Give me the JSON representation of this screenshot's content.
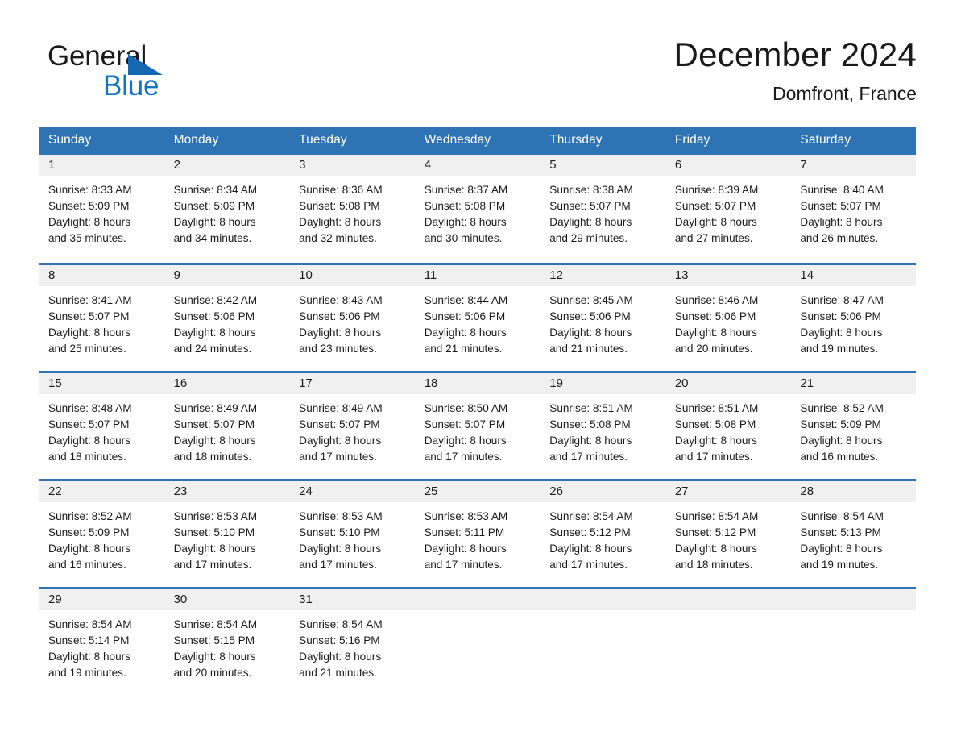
{
  "brand": {
    "name_top": "General",
    "name_bottom": "Blue",
    "accent_color": "#1174c4",
    "triangle_color": "#1667b2"
  },
  "header": {
    "title": "December 2024",
    "subtitle": "Domfront, France",
    "header_bg_color": "#2e74b5",
    "row_rule_color": "#2e74b5",
    "daynum_band_color": "#f0f0f0"
  },
  "weekday_headers": [
    "Sunday",
    "Monday",
    "Tuesday",
    "Wednesday",
    "Thursday",
    "Friday",
    "Saturday"
  ],
  "weeks": [
    [
      {
        "day": "1",
        "sunrise": "Sunrise: 8:33 AM",
        "sunset": "Sunset: 5:09 PM",
        "daylight_1": "Daylight: 8 hours",
        "daylight_2": "and 35 minutes."
      },
      {
        "day": "2",
        "sunrise": "Sunrise: 8:34 AM",
        "sunset": "Sunset: 5:09 PM",
        "daylight_1": "Daylight: 8 hours",
        "daylight_2": "and 34 minutes."
      },
      {
        "day": "3",
        "sunrise": "Sunrise: 8:36 AM",
        "sunset": "Sunset: 5:08 PM",
        "daylight_1": "Daylight: 8 hours",
        "daylight_2": "and 32 minutes."
      },
      {
        "day": "4",
        "sunrise": "Sunrise: 8:37 AM",
        "sunset": "Sunset: 5:08 PM",
        "daylight_1": "Daylight: 8 hours",
        "daylight_2": "and 30 minutes."
      },
      {
        "day": "5",
        "sunrise": "Sunrise: 8:38 AM",
        "sunset": "Sunset: 5:07 PM",
        "daylight_1": "Daylight: 8 hours",
        "daylight_2": "and 29 minutes."
      },
      {
        "day": "6",
        "sunrise": "Sunrise: 8:39 AM",
        "sunset": "Sunset: 5:07 PM",
        "daylight_1": "Daylight: 8 hours",
        "daylight_2": "and 27 minutes."
      },
      {
        "day": "7",
        "sunrise": "Sunrise: 8:40 AM",
        "sunset": "Sunset: 5:07 PM",
        "daylight_1": "Daylight: 8 hours",
        "daylight_2": "and 26 minutes."
      }
    ],
    [
      {
        "day": "8",
        "sunrise": "Sunrise: 8:41 AM",
        "sunset": "Sunset: 5:07 PM",
        "daylight_1": "Daylight: 8 hours",
        "daylight_2": "and 25 minutes."
      },
      {
        "day": "9",
        "sunrise": "Sunrise: 8:42 AM",
        "sunset": "Sunset: 5:06 PM",
        "daylight_1": "Daylight: 8 hours",
        "daylight_2": "and 24 minutes."
      },
      {
        "day": "10",
        "sunrise": "Sunrise: 8:43 AM",
        "sunset": "Sunset: 5:06 PM",
        "daylight_1": "Daylight: 8 hours",
        "daylight_2": "and 23 minutes."
      },
      {
        "day": "11",
        "sunrise": "Sunrise: 8:44 AM",
        "sunset": "Sunset: 5:06 PM",
        "daylight_1": "Daylight: 8 hours",
        "daylight_2": "and 21 minutes."
      },
      {
        "day": "12",
        "sunrise": "Sunrise: 8:45 AM",
        "sunset": "Sunset: 5:06 PM",
        "daylight_1": "Daylight: 8 hours",
        "daylight_2": "and 21 minutes."
      },
      {
        "day": "13",
        "sunrise": "Sunrise: 8:46 AM",
        "sunset": "Sunset: 5:06 PM",
        "daylight_1": "Daylight: 8 hours",
        "daylight_2": "and 20 minutes."
      },
      {
        "day": "14",
        "sunrise": "Sunrise: 8:47 AM",
        "sunset": "Sunset: 5:06 PM",
        "daylight_1": "Daylight: 8 hours",
        "daylight_2": "and 19 minutes."
      }
    ],
    [
      {
        "day": "15",
        "sunrise": "Sunrise: 8:48 AM",
        "sunset": "Sunset: 5:07 PM",
        "daylight_1": "Daylight: 8 hours",
        "daylight_2": "and 18 minutes."
      },
      {
        "day": "16",
        "sunrise": "Sunrise: 8:49 AM",
        "sunset": "Sunset: 5:07 PM",
        "daylight_1": "Daylight: 8 hours",
        "daylight_2": "and 18 minutes."
      },
      {
        "day": "17",
        "sunrise": "Sunrise: 8:49 AM",
        "sunset": "Sunset: 5:07 PM",
        "daylight_1": "Daylight: 8 hours",
        "daylight_2": "and 17 minutes."
      },
      {
        "day": "18",
        "sunrise": "Sunrise: 8:50 AM",
        "sunset": "Sunset: 5:07 PM",
        "daylight_1": "Daylight: 8 hours",
        "daylight_2": "and 17 minutes."
      },
      {
        "day": "19",
        "sunrise": "Sunrise: 8:51 AM",
        "sunset": "Sunset: 5:08 PM",
        "daylight_1": "Daylight: 8 hours",
        "daylight_2": "and 17 minutes."
      },
      {
        "day": "20",
        "sunrise": "Sunrise: 8:51 AM",
        "sunset": "Sunset: 5:08 PM",
        "daylight_1": "Daylight: 8 hours",
        "daylight_2": "and 17 minutes."
      },
      {
        "day": "21",
        "sunrise": "Sunrise: 8:52 AM",
        "sunset": "Sunset: 5:09 PM",
        "daylight_1": "Daylight: 8 hours",
        "daylight_2": "and 16 minutes."
      }
    ],
    [
      {
        "day": "22",
        "sunrise": "Sunrise: 8:52 AM",
        "sunset": "Sunset: 5:09 PM",
        "daylight_1": "Daylight: 8 hours",
        "daylight_2": "and 16 minutes."
      },
      {
        "day": "23",
        "sunrise": "Sunrise: 8:53 AM",
        "sunset": "Sunset: 5:10 PM",
        "daylight_1": "Daylight: 8 hours",
        "daylight_2": "and 17 minutes."
      },
      {
        "day": "24",
        "sunrise": "Sunrise: 8:53 AM",
        "sunset": "Sunset: 5:10 PM",
        "daylight_1": "Daylight: 8 hours",
        "daylight_2": "and 17 minutes."
      },
      {
        "day": "25",
        "sunrise": "Sunrise: 8:53 AM",
        "sunset": "Sunset: 5:11 PM",
        "daylight_1": "Daylight: 8 hours",
        "daylight_2": "and 17 minutes."
      },
      {
        "day": "26",
        "sunrise": "Sunrise: 8:54 AM",
        "sunset": "Sunset: 5:12 PM",
        "daylight_1": "Daylight: 8 hours",
        "daylight_2": "and 17 minutes."
      },
      {
        "day": "27",
        "sunrise": "Sunrise: 8:54 AM",
        "sunset": "Sunset: 5:12 PM",
        "daylight_1": "Daylight: 8 hours",
        "daylight_2": "and 18 minutes."
      },
      {
        "day": "28",
        "sunrise": "Sunrise: 8:54 AM",
        "sunset": "Sunset: 5:13 PM",
        "daylight_1": "Daylight: 8 hours",
        "daylight_2": "and 19 minutes."
      }
    ],
    [
      {
        "day": "29",
        "sunrise": "Sunrise: 8:54 AM",
        "sunset": "Sunset: 5:14 PM",
        "daylight_1": "Daylight: 8 hours",
        "daylight_2": "and 19 minutes."
      },
      {
        "day": "30",
        "sunrise": "Sunrise: 8:54 AM",
        "sunset": "Sunset: 5:15 PM",
        "daylight_1": "Daylight: 8 hours",
        "daylight_2": "and 20 minutes."
      },
      {
        "day": "31",
        "sunrise": "Sunrise: 8:54 AM",
        "sunset": "Sunset: 5:16 PM",
        "daylight_1": "Daylight: 8 hours",
        "daylight_2": "and 21 minutes."
      },
      {
        "day": "",
        "sunrise": "",
        "sunset": "",
        "daylight_1": "",
        "daylight_2": ""
      },
      {
        "day": "",
        "sunrise": "",
        "sunset": "",
        "daylight_1": "",
        "daylight_2": ""
      },
      {
        "day": "",
        "sunrise": "",
        "sunset": "",
        "daylight_1": "",
        "daylight_2": ""
      },
      {
        "day": "",
        "sunrise": "",
        "sunset": "",
        "daylight_1": "",
        "daylight_2": ""
      }
    ]
  ]
}
